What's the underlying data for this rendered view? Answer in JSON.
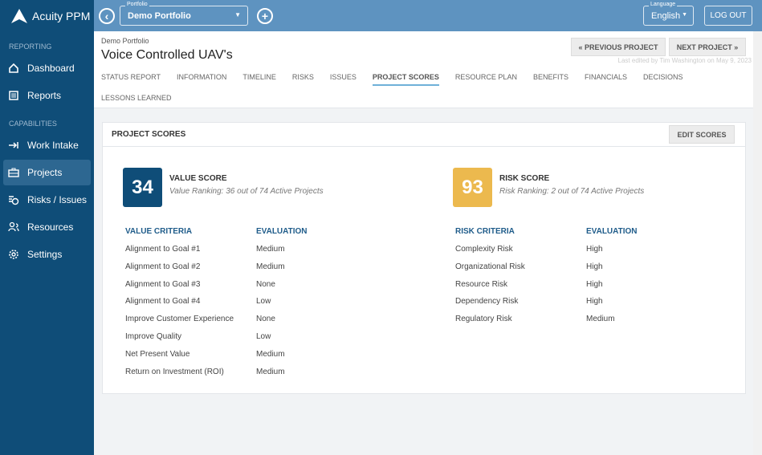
{
  "app": {
    "name": "Acuity PPM"
  },
  "sidebar": {
    "sections": [
      {
        "label": "REPORTING",
        "items": [
          {
            "label": "Dashboard",
            "icon": "home-icon"
          },
          {
            "label": "Reports",
            "icon": "list-icon"
          }
        ]
      },
      {
        "label": "CAPABILITIES",
        "items": [
          {
            "label": "Work Intake",
            "icon": "arrow-in-icon"
          },
          {
            "label": "Projects",
            "icon": "briefcase-icon",
            "active": true
          },
          {
            "label": "Risks / Issues",
            "icon": "risk-icon"
          },
          {
            "label": "Resources",
            "icon": "people-icon"
          },
          {
            "label": "Settings",
            "icon": "gear-icon"
          }
        ]
      }
    ]
  },
  "topbar": {
    "portfolio_label": "Portfolio",
    "portfolio_value": "Demo Portfolio",
    "language_label": "Language",
    "language_value": "English",
    "logout": "LOG OUT"
  },
  "header": {
    "breadcrumb": "Demo Portfolio",
    "title": "Voice Controlled UAV's",
    "prev": "« PREVIOUS PROJECT",
    "next": "NEXT PROJECT »",
    "last_edited": "Last edited by Tim Washington on May 9, 2023",
    "tabs": [
      {
        "label": "STATUS REPORT"
      },
      {
        "label": "INFORMATION"
      },
      {
        "label": "TIMELINE"
      },
      {
        "label": "RISKS"
      },
      {
        "label": "ISSUES"
      },
      {
        "label": "PROJECT SCORES",
        "active": true
      },
      {
        "label": "RESOURCE PLAN"
      },
      {
        "label": "BENEFITS"
      },
      {
        "label": "FINANCIALS"
      },
      {
        "label": "DECISIONS"
      },
      {
        "label": "LESSONS LEARNED"
      }
    ]
  },
  "card": {
    "title": "PROJECT SCORES",
    "edit": "EDIT SCORES",
    "value": {
      "score": "34",
      "title": "VALUE SCORE",
      "ranking": "Value Ranking: 36 out of 74 Active Projects",
      "color": "#0f4d78",
      "col1": "VALUE CRITERIA",
      "col2": "EVALUATION",
      "rows": [
        [
          "Alignment to Goal #1",
          "Medium"
        ],
        [
          "Alignment to Goal #2",
          "Medium"
        ],
        [
          "Alignment to Goal #3",
          "None"
        ],
        [
          "Alignment to Goal #4",
          "Low"
        ],
        [
          "Improve Customer Experience",
          "None"
        ],
        [
          "Improve Quality",
          "Low"
        ],
        [
          "Net Present Value",
          "Medium"
        ],
        [
          "Return on Investment (ROI)",
          "Medium"
        ]
      ]
    },
    "risk": {
      "score": "93",
      "title": "RISK SCORE",
      "ranking": "Risk Ranking: 2 out of 74 Active Projects",
      "color": "#ecb94e",
      "col1": "RISK CRITERIA",
      "col2": "EVALUATION",
      "rows": [
        [
          "Complexity Risk",
          "High"
        ],
        [
          "Organizational Risk",
          "High"
        ],
        [
          "Resource Risk",
          "High"
        ],
        [
          "Dependency Risk",
          "High"
        ],
        [
          "Regulatory Risk",
          "Medium"
        ]
      ]
    }
  }
}
